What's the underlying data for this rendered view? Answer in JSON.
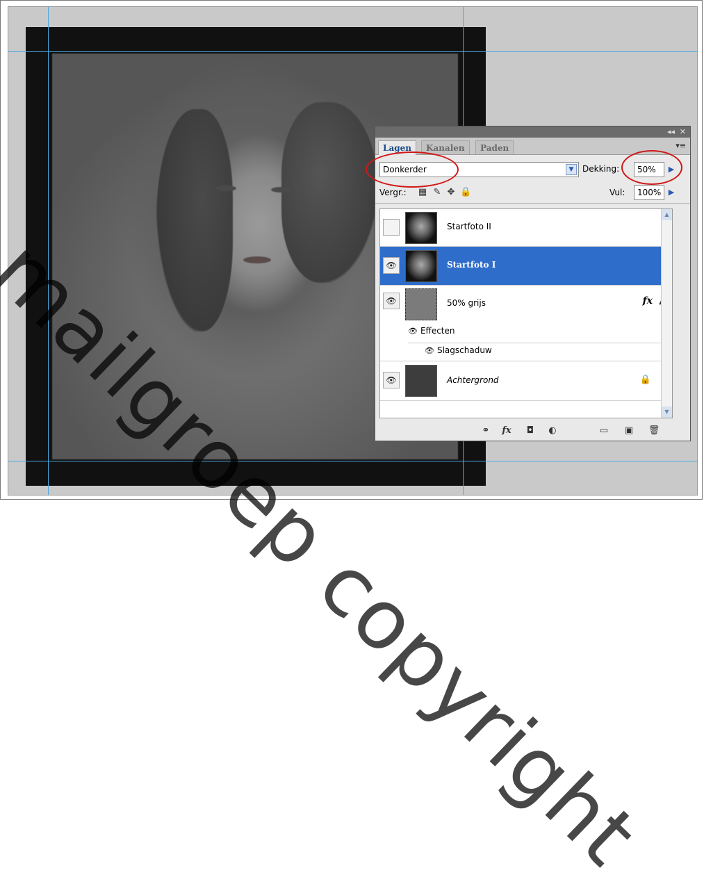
{
  "watermark": "mailgroep copyright",
  "panel": {
    "tabs": [
      "Lagen",
      "Kanalen",
      "Paden"
    ],
    "active_tab": "Lagen",
    "blend_mode": "Donkerder",
    "opacity_label": "Dekking:",
    "opacity_value": "50%",
    "lock_label": "Vergr.:",
    "fill_label": "Vul:",
    "fill_value": "100%",
    "layers": [
      {
        "name": "Startfoto II",
        "visible": false,
        "selected": false
      },
      {
        "name": "Startfoto I",
        "visible": true,
        "selected": true
      },
      {
        "name": "50% grijs",
        "visible": true,
        "selected": false,
        "fx": "fx"
      },
      {
        "name": "Achtergrond",
        "visible": true,
        "selected": false,
        "locked": true
      }
    ],
    "effects_label": "Effecten",
    "effect_item": "Slagschaduw"
  },
  "colors": {
    "selection": "#2f6dcb",
    "guide": "#4aa8e0",
    "annotation": "#d01818"
  }
}
